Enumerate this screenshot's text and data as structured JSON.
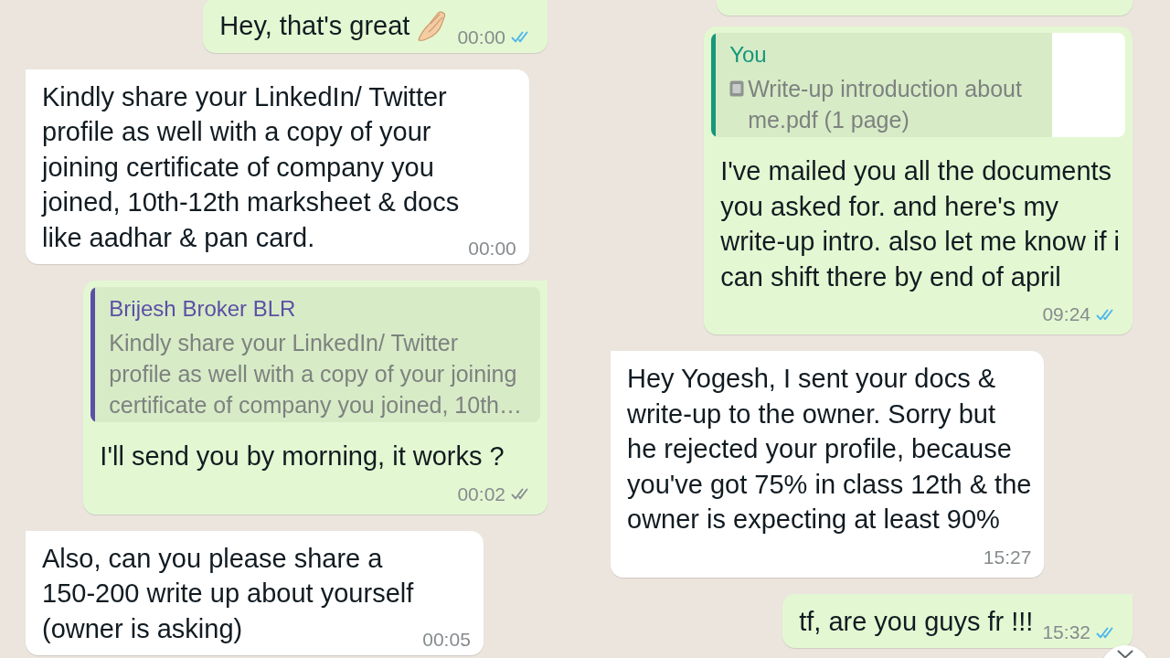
{
  "panels": [
    {
      "messages": [
        {
          "kind": "text",
          "outgoing": true,
          "tail": true,
          "text": "Hey, that's great",
          "has_emoji": true,
          "time": "00:00",
          "read": true
        },
        {
          "kind": "text",
          "outgoing": false,
          "tail": true,
          "text": "Kindly share your LinkedIn/ Twitter\nprofile as well with a copy of your\njoining certificate of company you\njoined, 10th-12th marksheet & docs\nlike aadhar & pan card.",
          "time": "00:00"
        },
        {
          "kind": "text",
          "outgoing": true,
          "tail": true,
          "quote": {
            "kind": "text",
            "author": "Brijesh Broker BLR",
            "color": "#5b4fa6",
            "text": "Kindly share your LinkedIn/ Twitter\nprofile as well with a copy of your joining\ncertificate of company you joined, 10th…"
          },
          "text": "I'll send you by morning, it works ?",
          "time": "00:02",
          "read": false
        },
        {
          "kind": "text",
          "outgoing": false,
          "tail": true,
          "text": "Also, can you please share a\n150-200 write up about yourself\n(owner is asking)",
          "time": "00:05"
        }
      ]
    },
    {
      "messages": [
        {
          "kind": "cut_off",
          "outgoing": true
        },
        {
          "kind": "text",
          "outgoing": true,
          "tail": false,
          "quote": {
            "kind": "document",
            "author": "You",
            "color": "#17977a",
            "text": "Write-up introduction about\nme.pdf (1 page)"
          },
          "text": "I've mailed you all the documents\nyou asked for. and here's my\nwrite-up intro. also let me know if i\ncan shift there by end of april",
          "time": "09:24",
          "read": true
        },
        {
          "kind": "text",
          "outgoing": false,
          "tail": true,
          "text": "Hey Yogesh, I sent your docs &\nwrite-up to the owner. Sorry but\nhe rejected your profile, because\nyou've got 75% in class 12th & the\nowner is expecting at least 90%",
          "time": "15:27"
        },
        {
          "kind": "text",
          "outgoing": true,
          "tail": true,
          "text": "tf, are you guys fr !!!",
          "time": "15:32",
          "read": true
        }
      ]
    }
  ]
}
